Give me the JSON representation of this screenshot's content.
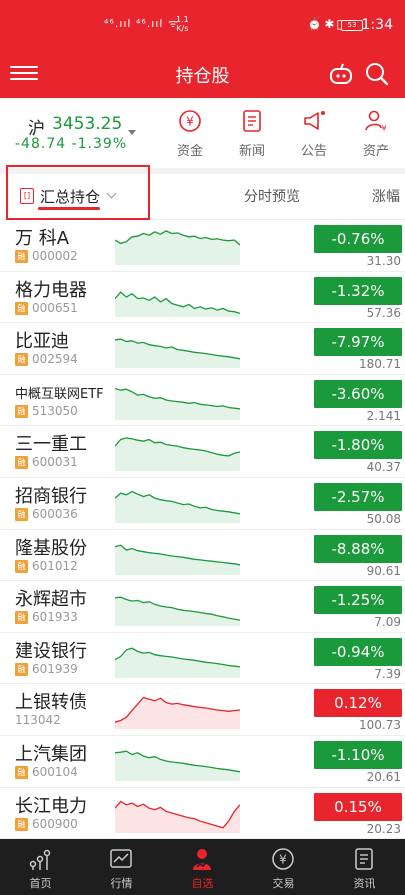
{
  "statusbar": {
    "network": "⁴⁶.ııl ⁴⁶.ııl ᯤ",
    "speed_value": "1.1",
    "speed_unit": "K/s",
    "icons": "⏰✱▯",
    "battery": "53",
    "time": "1:34"
  },
  "navbar": {
    "title": "持仓股"
  },
  "index": {
    "name": "沪",
    "value": "3453.25",
    "change": "-48.74",
    "change_pct": "-1.39%"
  },
  "quick_actions": [
    {
      "label": "资金"
    },
    {
      "label": "新闻"
    },
    {
      "label": "公告"
    },
    {
      "label": "资产"
    }
  ],
  "list_header": {
    "icon_text": "[]",
    "title": "汇总持仓",
    "mid": "分时预览",
    "right": "涨幅"
  },
  "tag_text": "融",
  "stocks": [
    {
      "name": "万 科A",
      "code": "000002",
      "margin": true,
      "change": "-0.76%",
      "price": "31.30",
      "dir": "down",
      "spark": [
        40,
        50,
        45,
        30,
        28,
        20,
        25,
        15,
        22,
        12,
        20,
        18,
        25,
        30,
        28,
        35,
        32,
        38,
        36,
        40,
        42,
        40,
        55
      ]
    },
    {
      "name": "格力电器",
      "code": "000651",
      "margin": true,
      "change": "-1.32%",
      "price": "57.36",
      "dir": "down",
      "spark": [
        60,
        40,
        55,
        45,
        60,
        58,
        65,
        55,
        70,
        60,
        75,
        80,
        85,
        78,
        90,
        85,
        92,
        88,
        95,
        90,
        98,
        100,
        105
      ]
    },
    {
      "name": "比亚迪",
      "code": "002594",
      "margin": true,
      "change": "-7.97%",
      "price": "180.71",
      "dir": "down",
      "spark": [
        30,
        28,
        35,
        33,
        40,
        38,
        45,
        48,
        50,
        55,
        52,
        60,
        62,
        65,
        68,
        70,
        72,
        75,
        78,
        80,
        82,
        85,
        88
      ]
    },
    {
      "name": "中概互联网ETF",
      "code": "513050",
      "margin": true,
      "change": "-3.60%",
      "price": "2.141",
      "dir": "down",
      "small": true,
      "spark": [
        20,
        25,
        22,
        30,
        40,
        38,
        45,
        50,
        48,
        55,
        58,
        60,
        62,
        65,
        63,
        68,
        70,
        72,
        75,
        73,
        78,
        80,
        82
      ]
    },
    {
      "name": "三一重工",
      "code": "600031",
      "margin": true,
      "change": "-1.80%",
      "price": "40.37",
      "dir": "down",
      "spark": [
        40,
        20,
        15,
        18,
        22,
        25,
        20,
        30,
        28,
        35,
        38,
        40,
        45,
        48,
        50,
        52,
        55,
        60,
        65,
        68,
        70,
        62,
        58
      ]
    },
    {
      "name": "招商银行",
      "code": "600036",
      "margin": true,
      "change": "-2.57%",
      "price": "50.08",
      "dir": "down",
      "spark": [
        40,
        25,
        30,
        20,
        28,
        35,
        30,
        40,
        45,
        48,
        50,
        55,
        60,
        58,
        65,
        70,
        68,
        75,
        78,
        80,
        82,
        85,
        88
      ]
    },
    {
      "name": "隆基股份",
      "code": "601012",
      "margin": true,
      "change": "-8.88%",
      "price": "90.61",
      "dir": "down",
      "spark": [
        30,
        25,
        40,
        35,
        42,
        45,
        48,
        50,
        52,
        55,
        58,
        60,
        62,
        65,
        68,
        70,
        72,
        74,
        76,
        78,
        80,
        82,
        85
      ]
    },
    {
      "name": "永辉超市",
      "code": "601933",
      "margin": true,
      "change": "-1.25%",
      "price": "7.09",
      "dir": "down",
      "spark": [
        30,
        28,
        35,
        40,
        38,
        45,
        42,
        50,
        55,
        58,
        60,
        65,
        68,
        70,
        72,
        75,
        78,
        80,
        85,
        88,
        92,
        95,
        98
      ]
    },
    {
      "name": "建设银行",
      "code": "601939",
      "margin": true,
      "change": "-0.94%",
      "price": "7.39",
      "dir": "down",
      "spark": [
        60,
        50,
        30,
        25,
        35,
        40,
        38,
        45,
        48,
        50,
        52,
        55,
        58,
        60,
        62,
        65,
        68,
        70,
        72,
        75,
        78,
        80,
        82
      ]
    },
    {
      "name": "上银转债",
      "code": "113042",
      "margin": false,
      "change": "0.12%",
      "price": "100.73",
      "dir": "up",
      "spark": [
        95,
        90,
        80,
        60,
        40,
        20,
        25,
        30,
        22,
        35,
        40,
        38,
        42,
        45,
        48,
        50,
        52,
        55,
        58,
        60,
        62,
        60,
        58
      ]
    },
    {
      "name": "上汽集团",
      "code": "600104",
      "margin": true,
      "change": "-1.10%",
      "price": "20.61",
      "dir": "down",
      "spark": [
        30,
        28,
        25,
        35,
        30,
        40,
        45,
        42,
        50,
        55,
        58,
        60,
        62,
        65,
        68,
        70,
        72,
        75,
        78,
        80,
        82,
        85,
        88
      ]
    },
    {
      "name": "长江电力",
      "code": "600900",
      "margin": true,
      "change": "0.15%",
      "price": "20.23",
      "dir": "up",
      "spark": [
        40,
        20,
        30,
        25,
        35,
        28,
        40,
        45,
        38,
        50,
        55,
        60,
        65,
        70,
        72,
        80,
        85,
        90,
        95,
        100,
        80,
        50,
        30
      ]
    }
  ],
  "tabs": [
    {
      "label": "首页",
      "active": false
    },
    {
      "label": "行情",
      "active": false
    },
    {
      "label": "自选",
      "active": true
    },
    {
      "label": "交易",
      "active": false
    },
    {
      "label": "资讯",
      "active": false
    }
  ],
  "colors": {
    "brand_red": "#e8242d",
    "down_green": "#1a9a3a",
    "tag_orange": "#f0a23a"
  }
}
